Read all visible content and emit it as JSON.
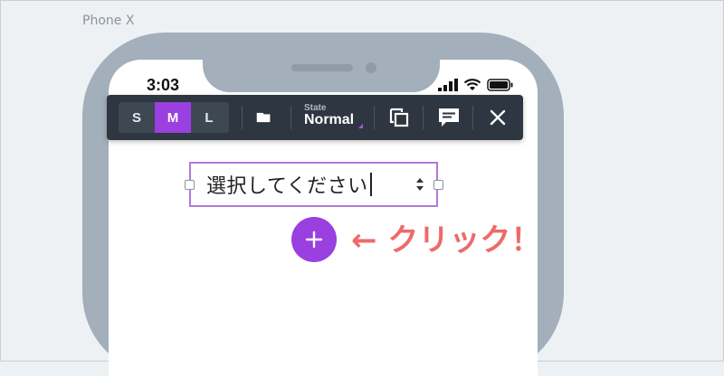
{
  "canvas": {
    "device_label": "Phone X"
  },
  "status_bar": {
    "time": "3:03",
    "icons": [
      "signal-icon",
      "wifi-icon",
      "battery-icon"
    ]
  },
  "toolbar": {
    "sizes": [
      {
        "label": "S",
        "active": false
      },
      {
        "label": "M",
        "active": true
      },
      {
        "label": "L",
        "active": false
      }
    ],
    "state_label": "State",
    "state_value": "Normal",
    "icons": [
      "folder-icon",
      "duplicate-icon",
      "comment-icon",
      "close-icon"
    ]
  },
  "select": {
    "value": "選択してください"
  },
  "add_button": {
    "icon": "plus-icon"
  },
  "annotation": {
    "text": "← クリック！"
  },
  "colors": {
    "accent": "#9a3fe0",
    "toolbar_bg": "#2d3641",
    "phone_frame": "#a3afba",
    "annotation": "#ee6a6a"
  }
}
